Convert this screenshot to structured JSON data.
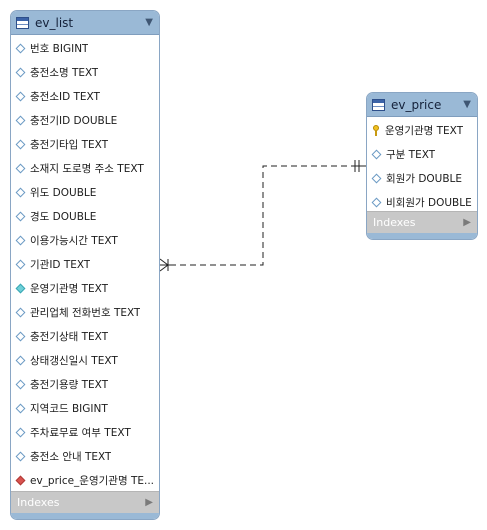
{
  "tables": [
    {
      "name": "ev_list",
      "collapse_arrow": "▼",
      "columns": [
        {
          "text": "번호 BIGINT",
          "marker": "diamond"
        },
        {
          "text": "충전소명 TEXT",
          "marker": "diamond"
        },
        {
          "text": "충전소ID TEXT",
          "marker": "diamond"
        },
        {
          "text": "충전기ID DOUBLE",
          "marker": "diamond"
        },
        {
          "text": "충전기타입 TEXT",
          "marker": "diamond"
        },
        {
          "text": "소재지 도로명 주소 TEXT",
          "marker": "diamond"
        },
        {
          "text": "위도 DOUBLE",
          "marker": "diamond"
        },
        {
          "text": "경도 DOUBLE",
          "marker": "diamond"
        },
        {
          "text": "이용가능시간 TEXT",
          "marker": "diamond"
        },
        {
          "text": "기관ID TEXT",
          "marker": "diamond"
        },
        {
          "text": "운영기관명 TEXT",
          "marker": "diamond-filled"
        },
        {
          "text": "관리업체 전화번호 TEXT",
          "marker": "diamond"
        },
        {
          "text": "충전기상태 TEXT",
          "marker": "diamond"
        },
        {
          "text": "상태갱신일시 TEXT",
          "marker": "diamond"
        },
        {
          "text": "충전기용량 TEXT",
          "marker": "diamond"
        },
        {
          "text": "지역코드 BIGINT",
          "marker": "diamond"
        },
        {
          "text": "주차료무료 여부 TEXT",
          "marker": "diamond"
        },
        {
          "text": "충전소 안내 TEXT",
          "marker": "diamond"
        },
        {
          "text": "ev_price_운영기관명 TE...",
          "marker": "diamond-fk"
        }
      ],
      "indexes_label": "Indexes",
      "indexes_arrow": "▶"
    },
    {
      "name": "ev_price",
      "collapse_arrow": "▼",
      "columns": [
        {
          "text": "운영기관명 TEXT",
          "marker": "key"
        },
        {
          "text": "구분 TEXT",
          "marker": "diamond"
        },
        {
          "text": "회원가 DOUBLE",
          "marker": "diamond"
        },
        {
          "text": "비회원가 DOUBLE",
          "marker": "diamond"
        }
      ],
      "indexes_label": "Indexes",
      "indexes_arrow": "▶"
    }
  ],
  "relationship": {
    "from_table": "ev_list",
    "to_table": "ev_price",
    "from_cardinality": "one-or-many",
    "to_cardinality": "exactly-one",
    "style": "dashed"
  },
  "colors": {
    "header_bg": "#9ab9d6",
    "border": "#8aa6c4",
    "indexes_bg": "#c8c8c8",
    "fk_marker": "#d9534f",
    "key_marker": "#f0c020"
  }
}
